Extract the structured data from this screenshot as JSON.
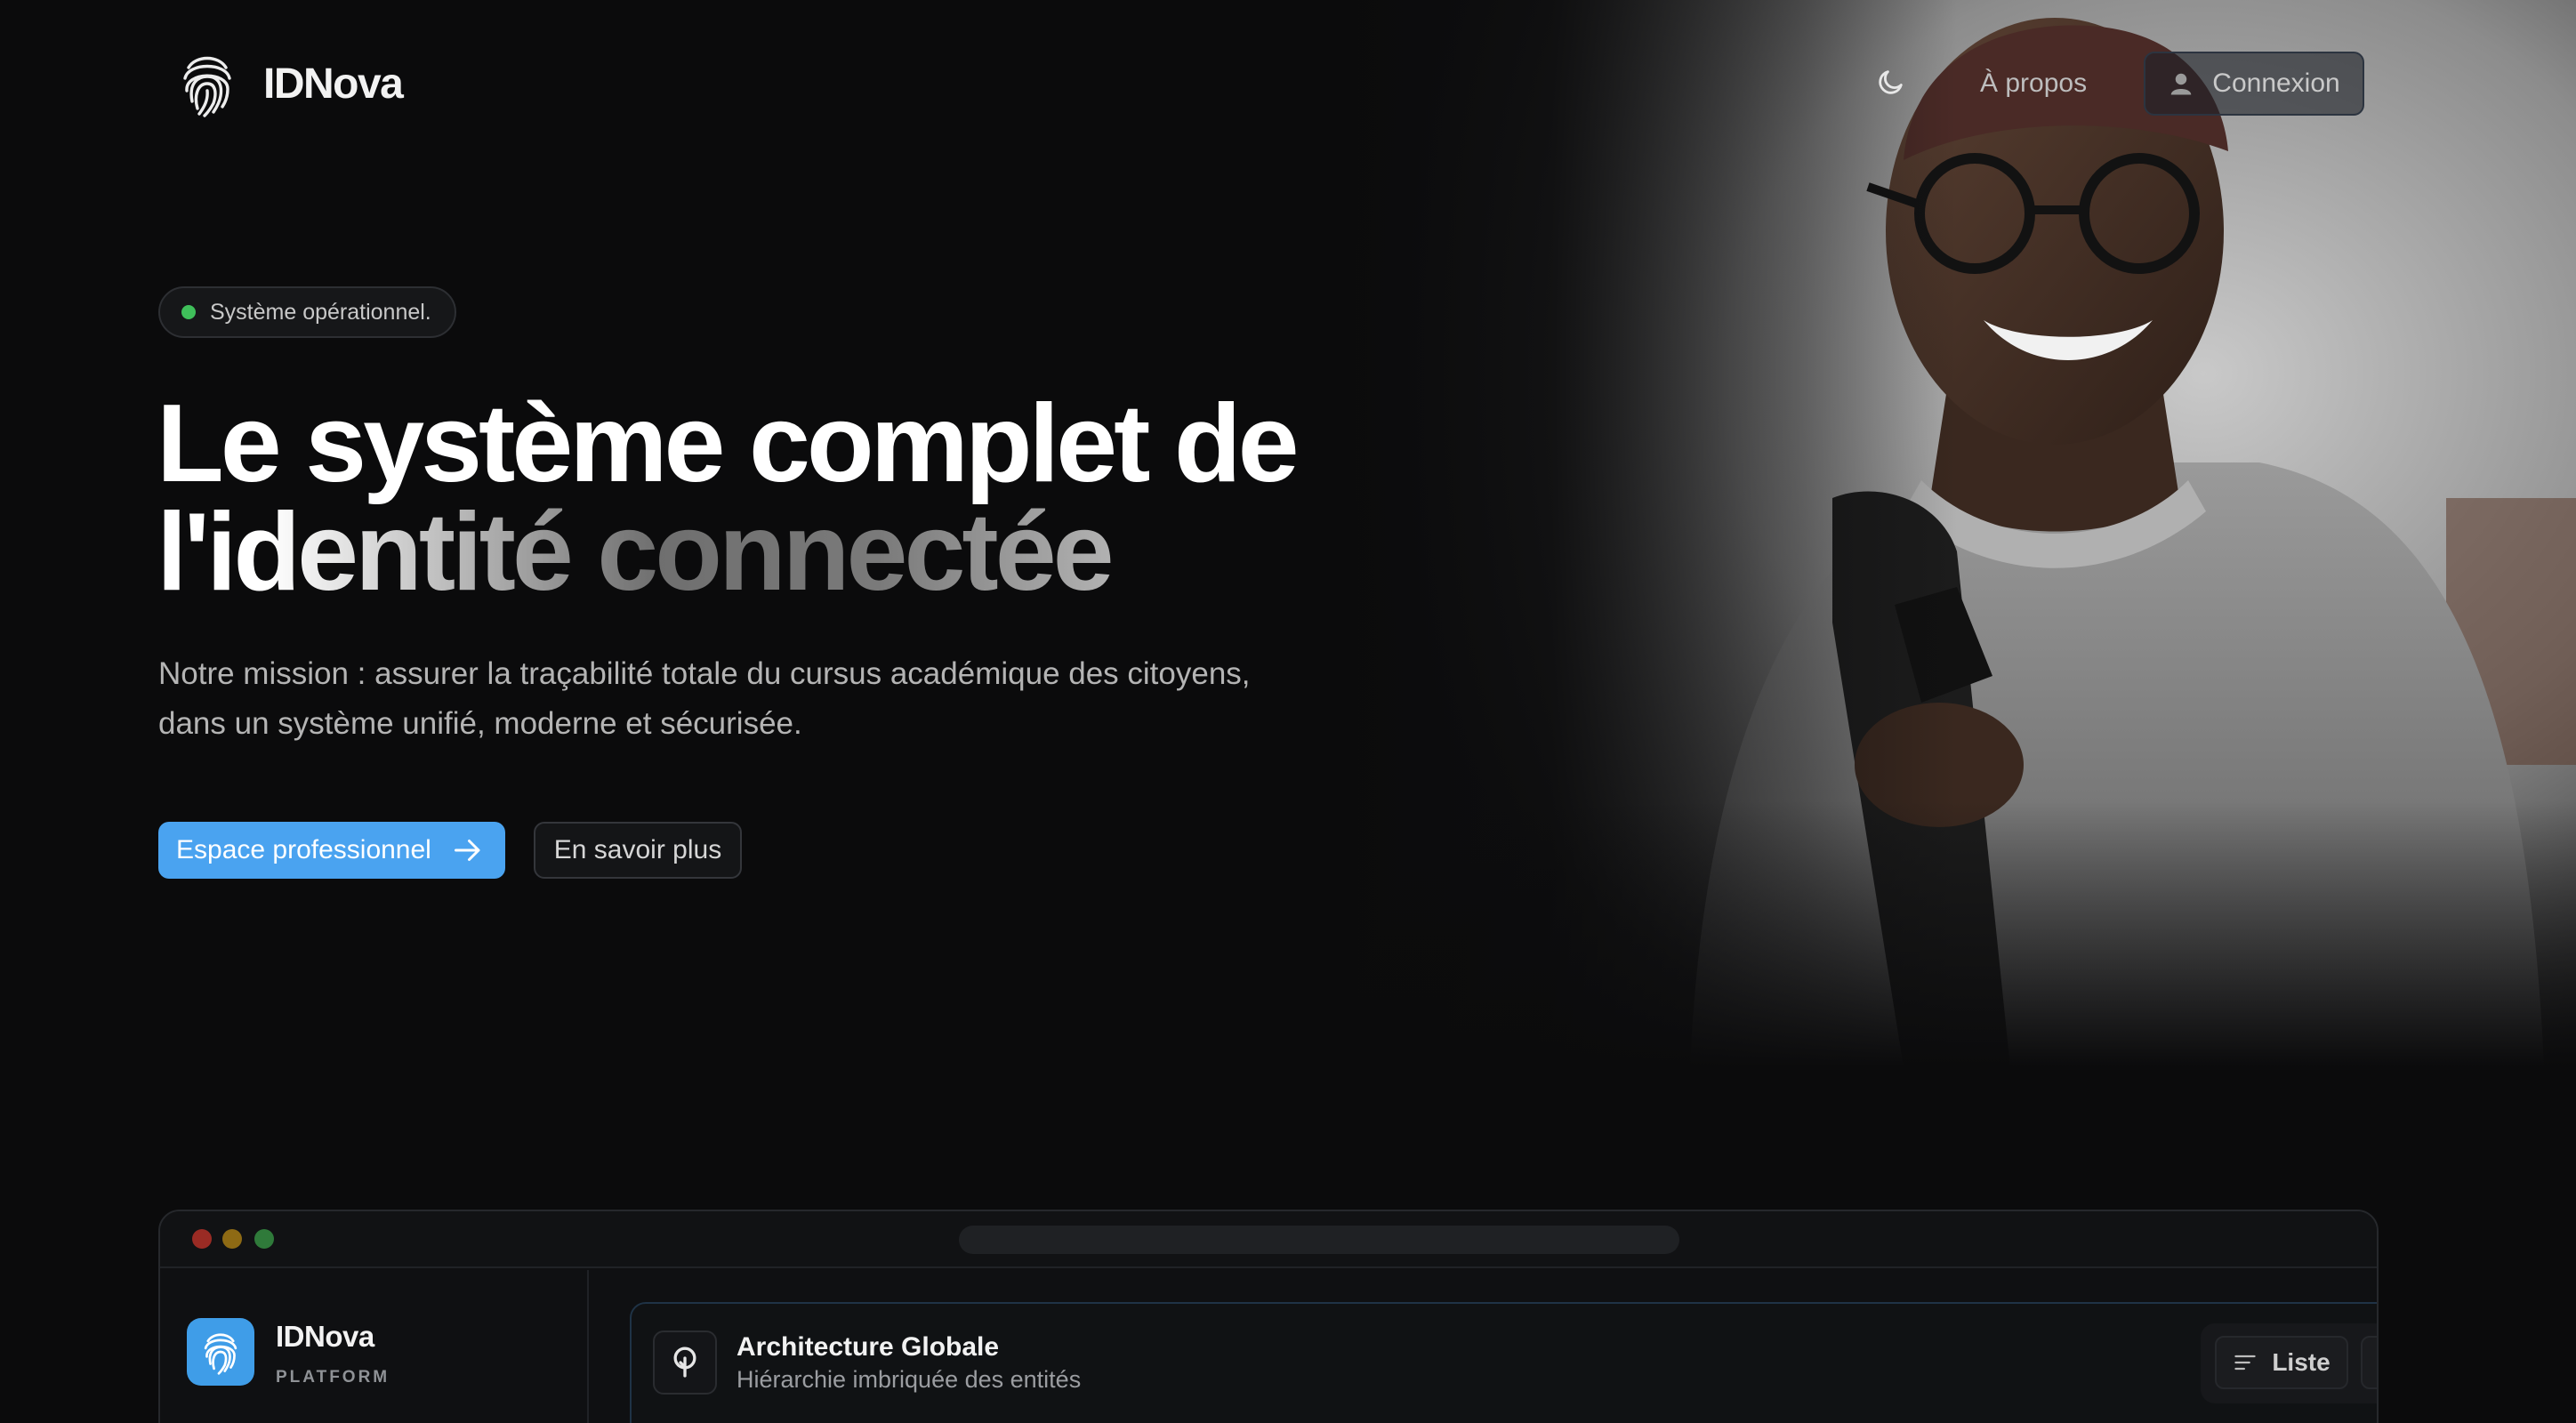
{
  "header": {
    "brand_name": "IDNova",
    "nav_about": "À propos",
    "login_label": "Connexion"
  },
  "hero": {
    "status_text": "Système opérationnel.",
    "title_line1": "Le système complet de",
    "title_line2": "l'identité connectée",
    "description_line1": "Notre mission : assurer la traçabilité totale du cursus académique des citoyens,",
    "description_line2": "dans un système unifié, moderne et sécurisée.",
    "primary_cta": "Espace professionnel",
    "secondary_cta": "En savoir plus"
  },
  "preview": {
    "app_name": "IDNova",
    "app_subtitle": "PLATFORM",
    "card_title": "Architecture Globale",
    "card_subtitle": "Hiérarchie imbriquée des entités",
    "list_view_label": "Liste"
  },
  "icons": {
    "brand": "fingerprint-icon",
    "theme": "moon-icon",
    "login": "user-icon",
    "cta_arrow": "arrow-right-icon",
    "card": "tree-icon",
    "list_view": "list-icon"
  },
  "colors": {
    "background": "#0b0b0c",
    "accent": "#4aa3f0",
    "status_ok": "#3fbf5a"
  }
}
